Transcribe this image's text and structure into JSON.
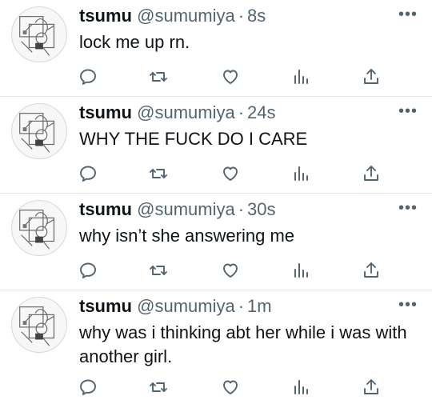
{
  "tweets": [
    {
      "name": "tsumu",
      "handle": "@sumumiya",
      "time": "8s",
      "text": "lock me up rn."
    },
    {
      "name": "tsumu",
      "handle": "@sumumiya",
      "time": "24s",
      "text": "WHY THE FUCK DO I CARE"
    },
    {
      "name": "tsumu",
      "handle": "@sumumiya",
      "time": "30s",
      "text": "why isn’t she answering me"
    },
    {
      "name": "tsumu",
      "handle": "@sumumiya",
      "time": "1m",
      "text": "why was i thinking abt her while i was with another girl."
    }
  ],
  "ui": {
    "more_glyph": "•••",
    "separator": "·",
    "icons": [
      "reply-icon",
      "retweet-icon",
      "like-icon",
      "views-icon",
      "share-icon"
    ],
    "icon_color": "#536471"
  }
}
